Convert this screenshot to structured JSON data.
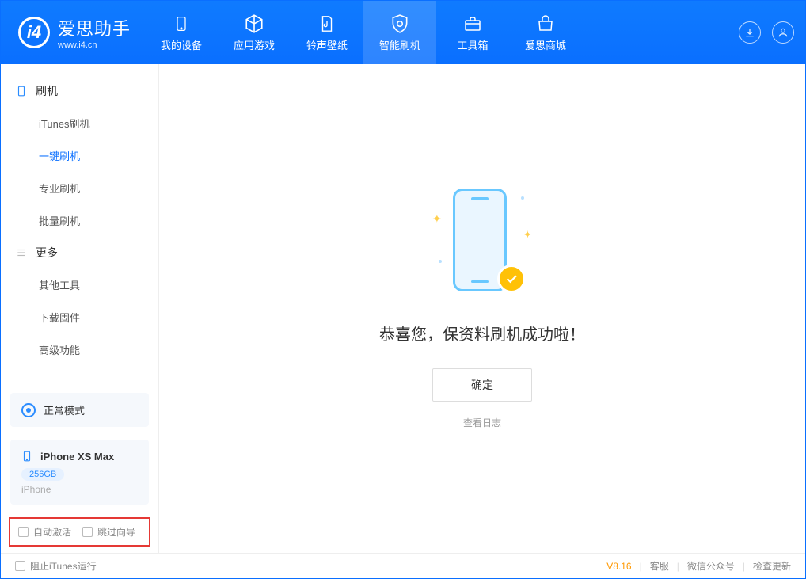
{
  "logo": {
    "name": "爱思助手",
    "url": "www.i4.cn"
  },
  "tabs": [
    {
      "label": "我的设备"
    },
    {
      "label": "应用游戏"
    },
    {
      "label": "铃声壁纸"
    },
    {
      "label": "智能刷机"
    },
    {
      "label": "工具箱"
    },
    {
      "label": "爱思商城"
    }
  ],
  "sidebar": {
    "group_flash": "刷机",
    "flash_items": [
      "iTunes刷机",
      "一键刷机",
      "专业刷机",
      "批量刷机"
    ],
    "group_more": "更多",
    "more_items": [
      "其他工具",
      "下载固件",
      "高级功能"
    ]
  },
  "device": {
    "mode_label": "正常模式",
    "name": "iPhone XS Max",
    "storage": "256GB",
    "type": "iPhone"
  },
  "options": {
    "auto_activate": "自动激活",
    "skip_guide": "跳过向导"
  },
  "main": {
    "success_title": "恭喜您，保资料刷机成功啦！",
    "ok_button": "确定",
    "view_log": "查看日志"
  },
  "footer": {
    "block_itunes": "阻止iTunes运行",
    "version": "V8.16",
    "support": "客服",
    "wechat": "微信公众号",
    "check_update": "检查更新"
  }
}
